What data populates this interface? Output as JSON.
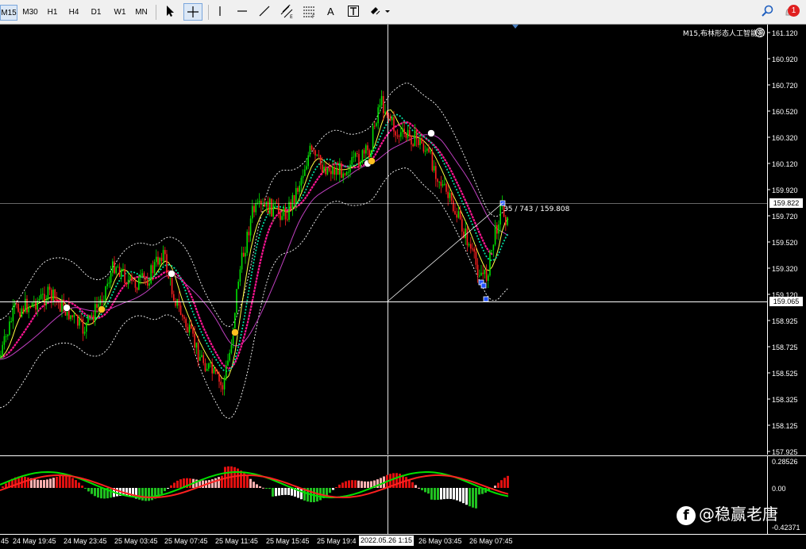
{
  "toolbar": {
    "timeframes": [
      "M15",
      "M30",
      "H1",
      "H4",
      "D1",
      "W1",
      "MN"
    ],
    "active_timeframe": "M15",
    "notification_count": "1",
    "tools": [
      "cursor-icon",
      "crosshair-icon",
      "vertical-line-icon",
      "horizontal-line-icon",
      "trendline-icon",
      "equidistant-channel-icon",
      "fibonacci-icon",
      "text-icon",
      "text-label-icon",
      "shapes-icon",
      "search-icon",
      "notification-bell-icon"
    ]
  },
  "chart": {
    "title": "M15,布林形态人工智能系",
    "symbol_timeframe": "M15",
    "current_price": "159.822",
    "crosshair_price": "159.065",
    "measure_label": "35 / 743 / 159.808",
    "price_labels": [
      "161.120",
      "160.920",
      "160.720",
      "160.520",
      "160.320",
      "160.120",
      "159.920",
      "159.720",
      "159.520",
      "159.320",
      "159.120",
      "158.925",
      "158.725",
      "158.525",
      "158.325",
      "158.125",
      "157.925"
    ],
    "colors": {
      "bull": "#00e000",
      "bear": "#ff2020",
      "bollinger": "#ffffff",
      "ma_fast": "#ffff40",
      "ma_mid": "#ff1493",
      "ma_slow": "#c040c0",
      "signal": "#00e0a0"
    }
  },
  "oscillator": {
    "labels": [
      "0.28526",
      "0.00",
      "-0.42371"
    ],
    "colors": {
      "pos_strong": "#e01010",
      "pos_weak": "#ffb0b0",
      "neg_weak": "#ffffff",
      "neg_strong": "#20c020",
      "line_a": "#00e000",
      "line_b": "#ff2020"
    }
  },
  "time_axis": {
    "labels": [
      "45",
      "24 May 19:45",
      "24 May 23:45",
      "25 May 03:45",
      "25 May 07:45",
      "25 May 11:45",
      "25 May 15:45",
      "25 May 19:4",
      "26 May 03:45",
      "26 May 07:45"
    ],
    "cursor_time": "2022.05.26 1:15"
  },
  "watermark": {
    "logo": "f",
    "text": "@稳赢老唐"
  }
}
